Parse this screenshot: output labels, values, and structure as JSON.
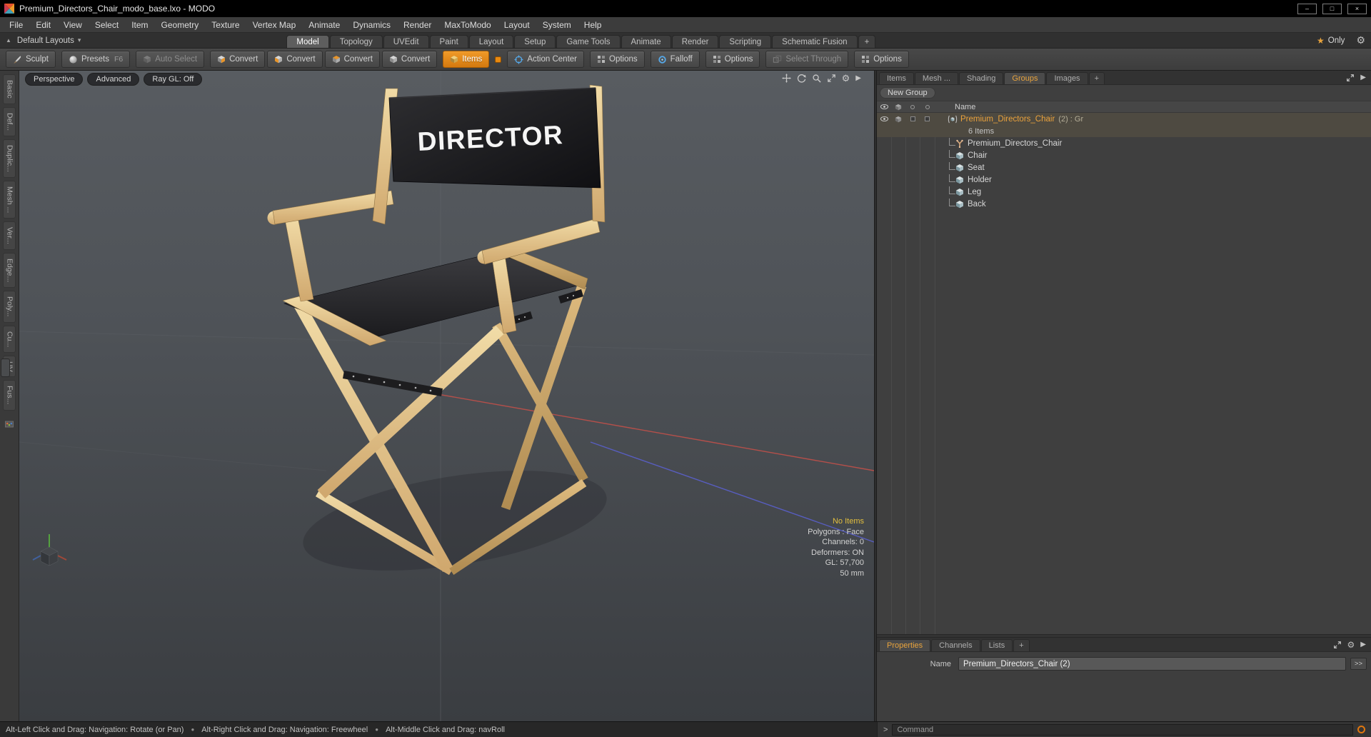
{
  "window": {
    "title": "Premium_Directors_Chair_modo_base.lxo - MODO",
    "minimize_glyph": "–",
    "maximize_glyph": "□",
    "close_glyph": "×"
  },
  "menubar": {
    "items": [
      "File",
      "Edit",
      "View",
      "Select",
      "Item",
      "Geometry",
      "Texture",
      "Vertex Map",
      "Animate",
      "Dynamics",
      "Render",
      "MaxToModo",
      "Layout",
      "System",
      "Help"
    ]
  },
  "layoutbar": {
    "up_arrow": "▲",
    "selector_label": "Default Layouts",
    "caret": "▾",
    "tabs": [
      "Model",
      "Topology",
      "UVEdit",
      "Paint",
      "Layout",
      "Setup",
      "Game Tools",
      "Animate",
      "Render",
      "Scripting",
      "Schematic Fusion"
    ],
    "add_tab": "+",
    "star": "★",
    "only_label": "Only",
    "gear": "⚙"
  },
  "toolbar": {
    "buttons": [
      "Sculpt",
      "Presets",
      "Auto Select",
      "Convert",
      "Convert",
      "Convert",
      "Convert",
      "Items",
      "Action Center",
      "Options",
      "Falloff",
      "Options",
      "Select Through",
      "Options"
    ],
    "presets_shortcut": "F6"
  },
  "left_toolbox": {
    "tabs": [
      "Basic",
      "Def...",
      "Duplic...",
      "Mesh ...",
      "Ver...",
      "Edge...",
      "Poly...",
      "Cu...",
      "UV",
      "Fus..."
    ]
  },
  "viewport": {
    "view_buttons": [
      "Perspective",
      "Advanced",
      "Ray GL: Off"
    ],
    "stats": [
      "No Items",
      "Polygons : Face",
      "Channels: 0",
      "Deformers: ON",
      "GL: 57,700",
      "50 mm"
    ],
    "canvas_text": "DIRECTOR"
  },
  "right_panel": {
    "tabs": [
      "Items",
      "Mesh ...",
      "Shading",
      "Groups",
      "Images"
    ],
    "add_tab": "+",
    "panel_arrow": "▶",
    "new_group_label": "New Group",
    "name_header": "Name",
    "group": {
      "name": "Premium_Directors_Chair",
      "meta": "(2) : Gr",
      "count": "6 Items",
      "children": [
        "Premium_Directors_Chair",
        "Chair",
        "Seat",
        "Holder",
        "Leg",
        "Back"
      ]
    }
  },
  "properties_panel": {
    "tabs": [
      "Properties",
      "Channels",
      "Lists"
    ],
    "add_tab": "+",
    "gear": "⚙",
    "panel_arrow": "▶",
    "name_label": "Name",
    "name_value": "Premium_Directors_Chair (2)",
    "expand_label": ">>"
  },
  "command_bar": {
    "prompt": ">",
    "placeholder": "Command"
  },
  "statusbar": {
    "hints": [
      "Alt-Left Click and Drag: Navigation: Rotate (or Pan)",
      "Alt-Right Click and Drag: Navigation: Freewheel",
      "Alt-Middle Click and Drag: navRoll"
    ],
    "bullet": "●"
  }
}
